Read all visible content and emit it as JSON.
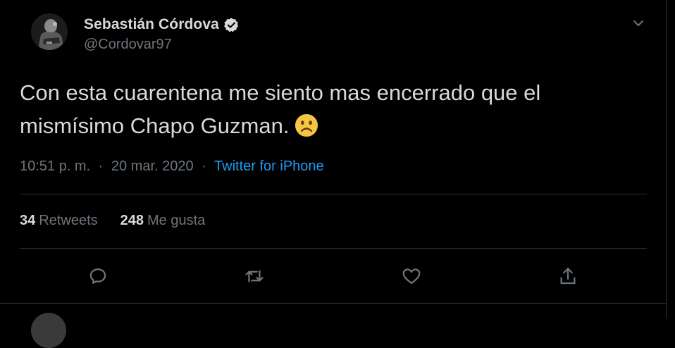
{
  "tweet": {
    "author": {
      "display_name": "Sebastián Córdova",
      "handle": "@Cordovar97",
      "verified": true
    },
    "text_line_1": "Con esta cuarentena me siento mas encerrado que el",
    "text_line_2": "mismísimo Chapo Guzman.",
    "emoji": "sad-face-emoji",
    "time": "10:51 p. m.",
    "separator": "·",
    "date": "20 mar. 2020",
    "source": "Twitter for iPhone",
    "retweets_count": "34",
    "retweets_label": "Retweets",
    "likes_count": "248",
    "likes_label": "Me gusta"
  },
  "icons": {
    "caret": "chevron-down-icon",
    "reply": "reply-icon",
    "retweet": "retweet-icon",
    "like": "heart-icon",
    "share": "share-icon",
    "verified": "verified-badge-icon"
  },
  "colors": {
    "background": "#000000",
    "text": "#d9d9d9",
    "muted": "#6e767d",
    "link": "#1d9bf0",
    "divider": "#2f3336",
    "emoji": "#f6c543"
  }
}
